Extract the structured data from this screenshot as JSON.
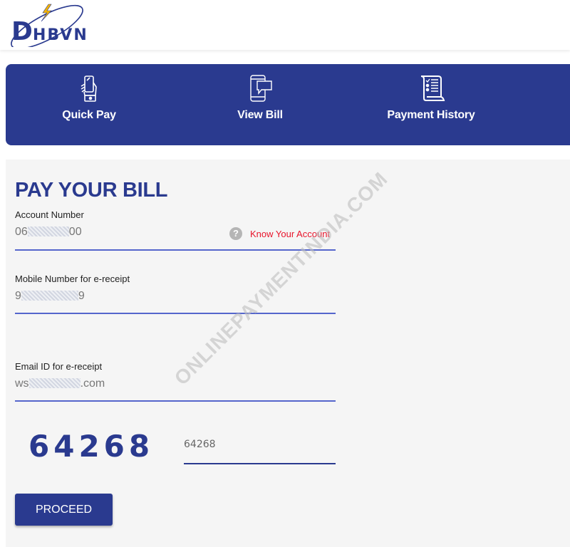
{
  "header": {
    "logo_text": "DHBVN",
    "logo_initial": "D",
    "logo_rest": "HBVN"
  },
  "nav": {
    "items": [
      {
        "label": "Quick Pay",
        "icon": "hand-phone-icon"
      },
      {
        "label": "View Bill",
        "icon": "phone-message-icon"
      },
      {
        "label": "Payment History",
        "icon": "scroll-list-icon"
      }
    ]
  },
  "form": {
    "title": "PAY YOUR BILL",
    "account": {
      "label": "Account Number",
      "value_prefix": "06",
      "value_suffix": "00"
    },
    "know_account": {
      "icon": "help-icon",
      "icon_glyph": "?",
      "label": "Know Your Account"
    },
    "mobile": {
      "label": "Mobile Number for e-receipt",
      "value_prefix": "9",
      "value_suffix": "9"
    },
    "email": {
      "label": "Email ID for e-receipt",
      "value_prefix": "ws",
      "value_suffix": ".com"
    },
    "captcha": {
      "image_text": "64268",
      "input_value": "64268"
    },
    "proceed_label": "PROCEED"
  },
  "watermark": "ONLINEPAYMENTINDIA.COM",
  "colors": {
    "brand": "#2a3a8f",
    "accent_line": "#5566cc",
    "link_red": "#e8142b"
  }
}
